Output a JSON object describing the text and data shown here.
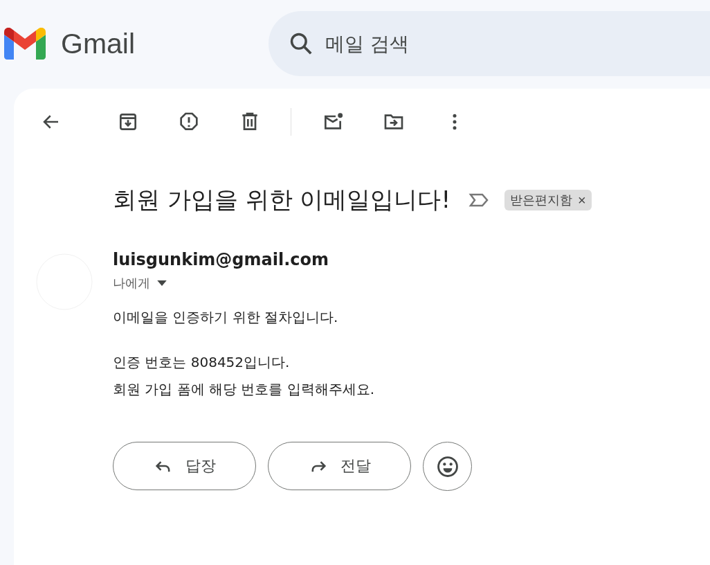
{
  "header": {
    "product": "Gmail",
    "search": {
      "placeholder": "메일 검색"
    }
  },
  "message": {
    "subject": "회원 가입을 위한 이메일입니다!",
    "labels": [
      {
        "text": "받은편지함",
        "close": "×"
      }
    ],
    "sender": "luisgunkim@gmail.com",
    "recipient": "나에게",
    "body": [
      [
        "이메일을 인증하기 위한 절차입니다."
      ],
      [
        "인증 번호는 808452입니다.",
        "회원 가입 폼에 해당 번호를 입력해주세요."
      ]
    ]
  },
  "actions": [
    {
      "kind": "reply",
      "label": "답장"
    },
    {
      "kind": "forward",
      "label": "전달"
    }
  ]
}
